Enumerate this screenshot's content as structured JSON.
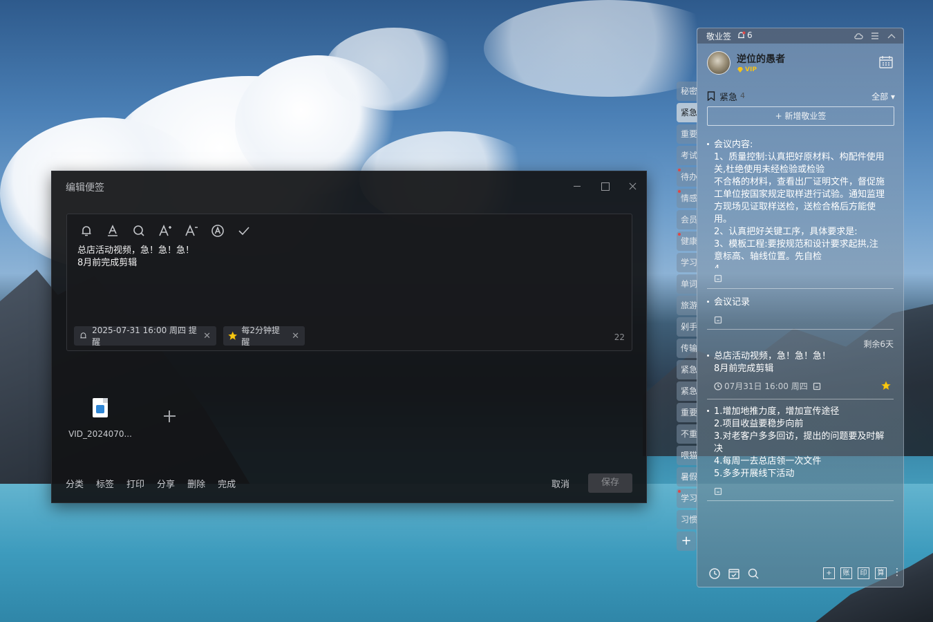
{
  "editor": {
    "title": "编辑便签",
    "note_lines": [
      "总店活动视频，急！急！急！",
      "8月前完成剪辑"
    ],
    "reminder_chip": "2025-07-31 16:00 周四 提醒",
    "repeat_chip": "每2分钟提醒",
    "char_count": "22",
    "attachment_name": "VID_2024070...",
    "actions": [
      "分类",
      "标签",
      "打印",
      "分享",
      "删除",
      "完成"
    ],
    "cancel_label": "取消",
    "save_label": "保存"
  },
  "side_tabs": [
    {
      "label": "秘密",
      "active": false,
      "flag": false
    },
    {
      "label": "紧急",
      "active": true,
      "flag": false
    },
    {
      "label": "重要",
      "active": false,
      "flag": false
    },
    {
      "label": "考试",
      "active": false,
      "flag": false
    },
    {
      "label": "待办",
      "active": false,
      "flag": true
    },
    {
      "label": "情感",
      "active": false,
      "flag": true
    },
    {
      "label": "会员",
      "active": false,
      "flag": false
    },
    {
      "label": "健康",
      "active": false,
      "flag": true
    },
    {
      "label": "学习",
      "active": false,
      "flag": false
    },
    {
      "label": "单词",
      "active": false,
      "flag": false
    },
    {
      "label": "旅游",
      "active": false,
      "flag": false
    },
    {
      "label": "剁手",
      "active": false,
      "flag": false
    },
    {
      "label": "传输",
      "active": false,
      "flag": false
    },
    {
      "label": "紧急",
      "active": false,
      "flag": false
    },
    {
      "label": "紧急",
      "active": false,
      "flag": false
    },
    {
      "label": "重要",
      "active": false,
      "flag": false
    },
    {
      "label": "不重",
      "active": false,
      "flag": false
    },
    {
      "label": "喂猫",
      "active": false,
      "flag": false
    },
    {
      "label": "暑假",
      "active": false,
      "flag": false
    },
    {
      "label": "学习",
      "active": false,
      "flag": true
    },
    {
      "label": "习惯",
      "active": false,
      "flag": false
    }
  ],
  "panel": {
    "app_title": "敬业签",
    "bell_count": "6",
    "username": "逆位的愚者",
    "vip_label": "VIP",
    "category_name": "紧急",
    "category_count": "4",
    "category_filter": "全部",
    "add_note_label": "+ 新增敬业签",
    "notes": [
      {
        "body": "会议内容:\n1、质量控制:认真把好原材料、构配件使用关,杜绝使用未经检验或检验\n不合格的材料，查看出厂证明文件，督促施工单位按国家规定取样进行试验。通知监理方现场见证取样送检，送检合格后方能使用。\n2、认真把好关键工序，具体要求是:\n3、模板工程:要按规范和设计要求起拱,注意标高、轴线位置。先自检\n4、"
      },
      {
        "body": "会议记录"
      },
      {
        "remaining": "剩余6天",
        "body": "总店活动视频，急！急！急！\n8月前完成剪辑",
        "meta": "07月31日 16:00 周四"
      },
      {
        "body": "1.增加地推力度，增加宣传途径\n2.项目收益要稳步向前\n3.对老客户多多回访，提出的问题要及时解决\n4.每周一去总店领一次文件\n5.多多开展线下活动"
      }
    ],
    "bottom_boxes": [
      "+",
      "账",
      "印",
      "算"
    ]
  }
}
